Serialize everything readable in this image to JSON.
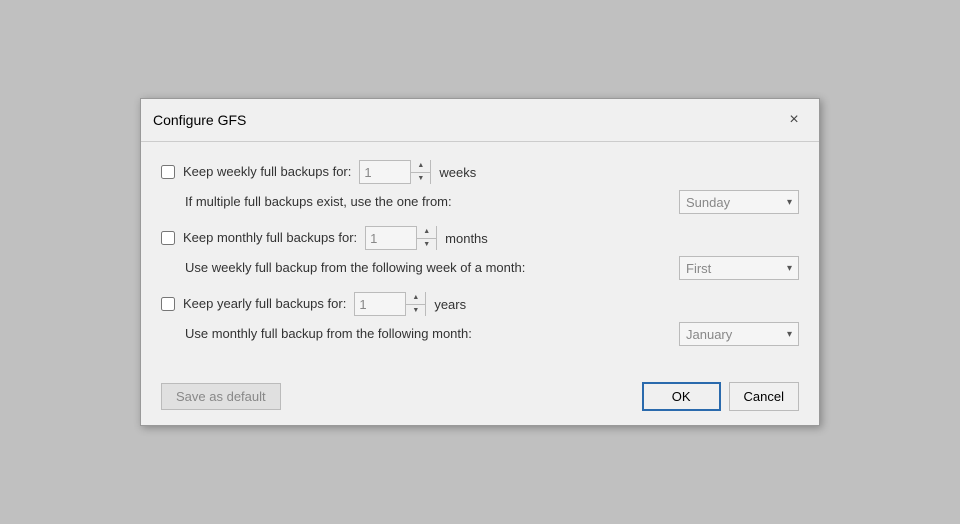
{
  "dialog": {
    "title": "Configure GFS",
    "close_label": "×"
  },
  "weekly": {
    "checkbox_checked": false,
    "main_label": "Keep weekly full backups for:",
    "spinner_value": "1",
    "unit": "weeks",
    "sub_label": "If multiple full backups exist, use the one from:",
    "dropdown_value": "Sunday",
    "dropdown_arrow": "▾"
  },
  "monthly": {
    "checkbox_checked": false,
    "main_label": "Keep monthly full backups for:",
    "spinner_value": "1",
    "unit": "months",
    "sub_label": "Use weekly full backup from the following week of a month:",
    "dropdown_value": "First",
    "dropdown_arrow": "▾"
  },
  "yearly": {
    "checkbox_checked": false,
    "main_label": "Keep yearly full backups for:",
    "spinner_value": "1",
    "unit": "years",
    "sub_label": "Use monthly full backup from the following month:",
    "dropdown_value": "January",
    "dropdown_arrow": "▾"
  },
  "footer": {
    "save_default_label": "Save as default",
    "ok_label": "OK",
    "cancel_label": "Cancel"
  }
}
